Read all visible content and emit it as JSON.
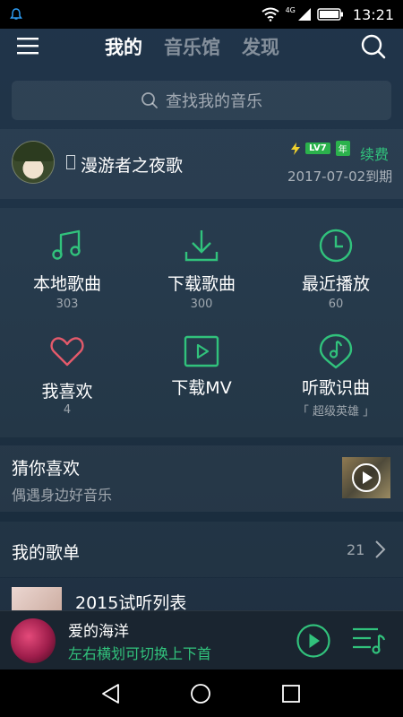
{
  "status_bar": {
    "time": "13:21",
    "network": "4G",
    "icons": [
      "notification-icon",
      "wifi-icon",
      "signal-icon",
      "battery-icon"
    ]
  },
  "nav": {
    "tabs": [
      {
        "label": "我的",
        "active": true
      },
      {
        "label": "音乐馆",
        "active": false
      },
      {
        "label": "发现",
        "active": false
      }
    ]
  },
  "search": {
    "placeholder": "查找我的音乐"
  },
  "profile": {
    "nickname": "漫游者之夜歌",
    "vip_level": "LV7",
    "vip_year": "年",
    "renew_label": "续费",
    "expire_text": "2017-07-02到期"
  },
  "grid": [
    {
      "label": "本地歌曲",
      "count": "303",
      "icon": "music-note-icon"
    },
    {
      "label": "下载歌曲",
      "count": "300",
      "icon": "download-icon"
    },
    {
      "label": "最近播放",
      "count": "60",
      "icon": "clock-icon"
    },
    {
      "label": "我喜欢",
      "count": "4",
      "icon": "heart-icon"
    },
    {
      "label": "下载MV",
      "count": "",
      "icon": "video-play-icon"
    },
    {
      "label": "听歌识曲",
      "count": "「 超级英雄 」",
      "icon": "music-recognize-icon"
    }
  ],
  "guess": {
    "title": "猜你喜欢",
    "subtitle": "偶遇身边好音乐"
  },
  "playlist": {
    "title": "我的歌单",
    "count": "21",
    "first_item": "2015试听列表"
  },
  "player": {
    "song_title": "爱的海洋",
    "hint": "左右横划可切换上下首"
  },
  "colors": {
    "accent": "#31c27c",
    "heart": "#e45a6b",
    "background": "#1f3346"
  }
}
